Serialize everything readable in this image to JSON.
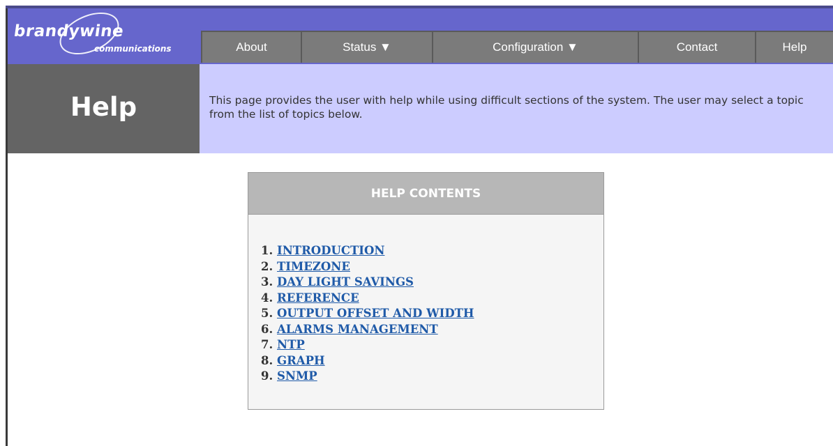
{
  "logo": {
    "word1": "brandywine",
    "word2": "communications"
  },
  "nav": {
    "about": "About",
    "status": "Status ▼",
    "configuration": "Configuration ▼",
    "contact": "Contact",
    "help": "Help"
  },
  "page": {
    "title": "Help",
    "description": "This page provides the user with help while using difficult sections of the system. The user may select a topic from the list of topics below."
  },
  "help_contents": {
    "heading": "HELP CONTENTS",
    "topics": [
      {
        "number": "1.",
        "label": "INTRODUCTION"
      },
      {
        "number": "2.",
        "label": "TIMEZONE"
      },
      {
        "number": "3.",
        "label": "DAY LIGHT SAVINGS"
      },
      {
        "number": "4.",
        "label": "REFERENCE"
      },
      {
        "number": "5.",
        "label": "OUTPUT OFFSET AND WIDTH"
      },
      {
        "number": "6.",
        "label": "ALARMS MANAGEMENT"
      },
      {
        "number": "7.",
        "label": "NTP"
      },
      {
        "number": "8.",
        "label": "GRAPH"
      },
      {
        "number": "9.",
        "label": "SNMP"
      }
    ]
  },
  "colors": {
    "header_bg": "#6666cc",
    "nav_bg": "#7b7b7b",
    "intro_bg": "#ccccff",
    "title_bg": "#646464",
    "link": "#1f5aa8"
  }
}
